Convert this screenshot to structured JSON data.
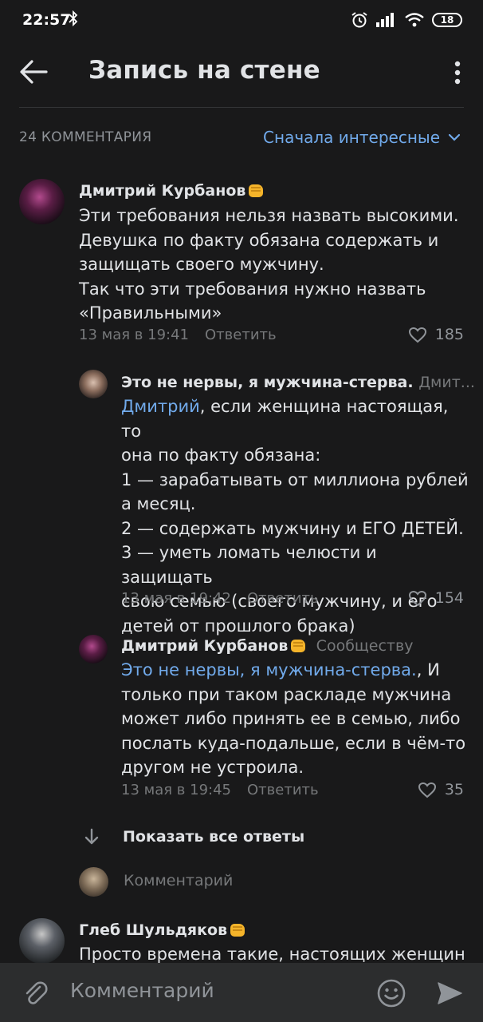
{
  "status_bar": {
    "time": "22:57",
    "battery": "18"
  },
  "header": {
    "title": "Запись на стене"
  },
  "comments_header": {
    "count": "24 КОММЕНТАРИЯ",
    "sort": "Сначала интересные"
  },
  "comments": [
    {
      "author": "Дмитрий Курбанов",
      "lines": [
        "Эти требования нельзя назвать высокими.",
        "Девушка по факту обязана содержать и",
        "защищать своего мужчину.",
        "Так что эти требования нужно назвать",
        "«Правильными»"
      ],
      "date": "13 мая в 19:41",
      "reply": "Ответить",
      "likes": "185"
    },
    {
      "author": "Это не нервы, я мужчина-стерва.",
      "reply_to": "Дмит...",
      "mention": "Дмитрий",
      "first_rest": ", если женщина настоящая, то",
      "lines": [
        "она по факту обязана:",
        "1 — зарабатывать от миллиона рублей",
        "а месяц.",
        "2 — содержать мужчину и ЕГО ДЕТЕЙ.",
        "3 — уметь ломать челюсти и защищать",
        "свою семью (своего мужчину, и его",
        "детей от прошлого брака)"
      ],
      "date": "13 мая в 19:42",
      "reply": "Ответить",
      "likes": "154"
    },
    {
      "author": "Дмитрий Курбанов",
      "reply_to": "Сообществу",
      "mention": "Это не нервы, я мужчина-стерва.",
      "first_rest": ", И",
      "lines": [
        "только при таком раскладе мужчина",
        "может либо принять ее в семью, либо",
        "послать куда-подальше, если в чём-то",
        "другом не устроила."
      ],
      "date": "13 мая в 19:45",
      "reply": "Ответить",
      "likes": "35"
    },
    {
      "author": "Глеб Шульдяков",
      "lines": [
        "Просто времена такие, настоящих женщин"
      ]
    }
  ],
  "show_all_replies": "Показать все ответы",
  "comment_stub": "Комментарий",
  "bottom_bar": {
    "placeholder": "Комментарий"
  }
}
